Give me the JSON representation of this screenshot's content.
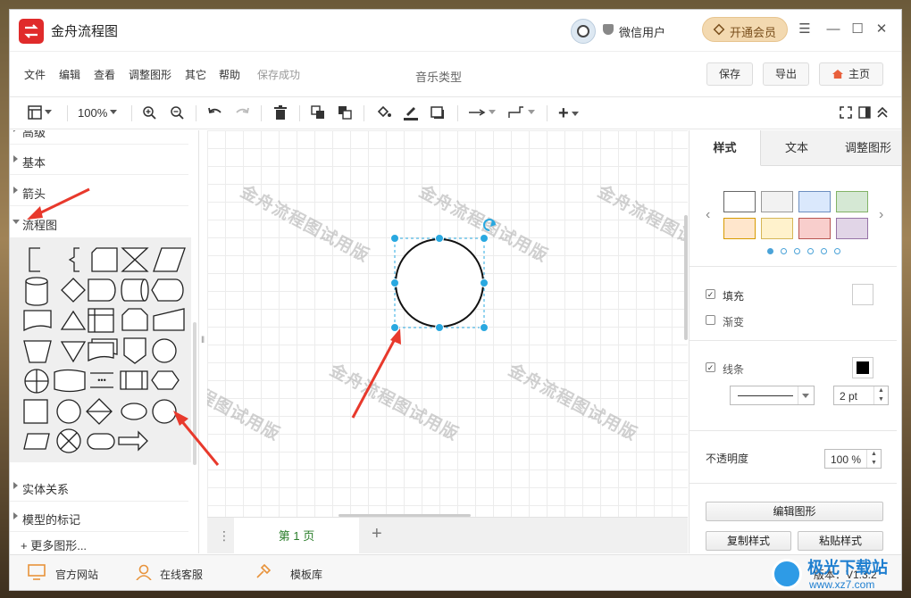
{
  "app": {
    "title": "金舟流程图",
    "user_name": "微信用户",
    "vip_label": "开通会员",
    "version": "版本：V1.3.2"
  },
  "menu": {
    "items": [
      "文件",
      "编辑",
      "查看",
      "调整图形",
      "其它",
      "帮助"
    ],
    "save_status": "保存成功",
    "doc_title": "音乐类型",
    "save_button": "保存",
    "export_button": "导出",
    "home_button": "主页"
  },
  "toolbar": {
    "zoom": "100%"
  },
  "left_panel": {
    "categories_top": [
      "高级",
      "基本",
      "箭头",
      "流程图"
    ],
    "categories_bottom": [
      "实体关系",
      "模型的标记"
    ],
    "more_shapes": "+ 更多图形..."
  },
  "canvas": {
    "watermark": "金舟流程图试用版"
  },
  "pages": {
    "current": "第 1 页"
  },
  "right_panel": {
    "tabs": [
      "样式",
      "文本",
      "调整图形"
    ],
    "swatches": [
      "#ffffff",
      "#f2f2f2",
      "#dae8fc",
      "#d5e8d4",
      "#ffe6cc",
      "#fff2cc",
      "#f8cecc",
      "#e1d5e7"
    ],
    "fill_label": "填充",
    "fill_checked": true,
    "gradient_label": "渐变",
    "gradient_checked": false,
    "line_label": "线条",
    "line_checked": true,
    "line_width": "2 pt",
    "opacity_label": "不透明度",
    "opacity_value": "100 %",
    "edit_shape_button": "编辑图形",
    "copy_style_button": "复制样式",
    "paste_style_button": "粘贴样式"
  },
  "status_bar": {
    "website": "官方网站",
    "support": "在线客服",
    "templates": "模板库"
  },
  "site_watermark": {
    "name": "极光下载站",
    "url": "www.xz7.com"
  }
}
